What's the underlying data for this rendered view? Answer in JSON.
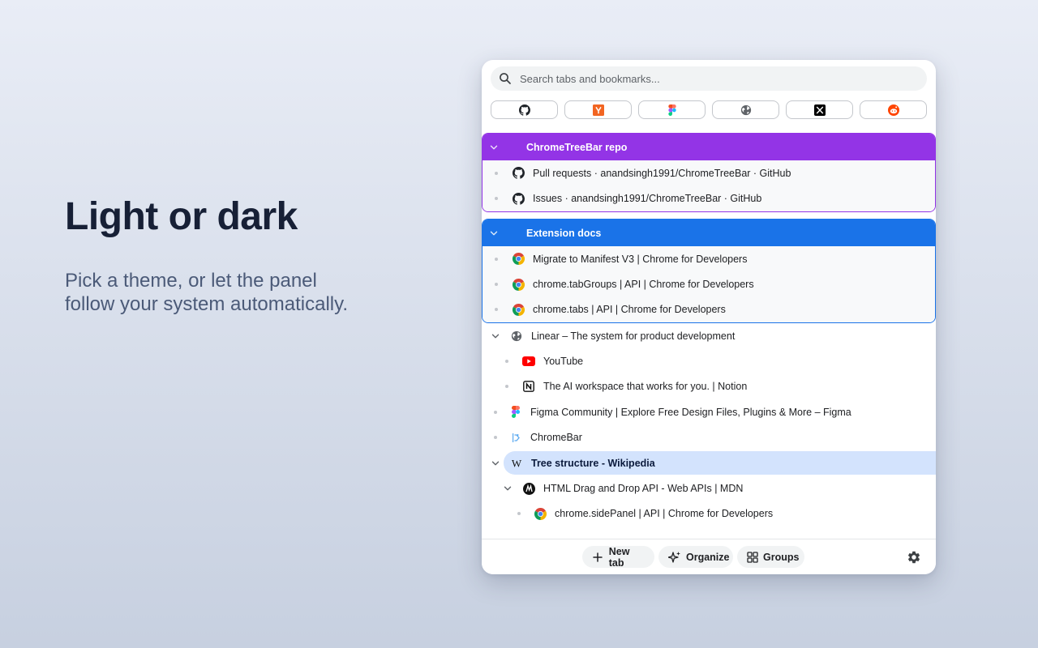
{
  "hero": {
    "title": "Light or dark",
    "subtitle_line1": "Pick a theme, or let the panel",
    "subtitle_line2": "follow your system automatically."
  },
  "search": {
    "placeholder": "Search tabs and bookmarks..."
  },
  "pinned": [
    {
      "icon": "github-icon"
    },
    {
      "icon": "ycombinator-icon"
    },
    {
      "icon": "figma-icon"
    },
    {
      "icon": "globe-icon"
    },
    {
      "icon": "x-icon"
    },
    {
      "icon": "reddit-icon"
    }
  ],
  "groups": [
    {
      "name": "ChromeTreeBar repo",
      "color": "#9334e6",
      "tabs": [
        {
          "title": "Pull requests · anandsingh1991/ChromeTreeBar · GitHub",
          "icon": "github-icon"
        },
        {
          "title": "Issues · anandsingh1991/ChromeTreeBar · GitHub",
          "icon": "github-icon"
        }
      ]
    },
    {
      "name": "Extension docs",
      "color": "#1a73e8",
      "tabs": [
        {
          "title": "Migrate to Manifest V3  |  Chrome for Developers",
          "icon": "chrome-icon"
        },
        {
          "title": "chrome.tabGroups  |  API  |  Chrome for Developers",
          "icon": "chrome-icon"
        },
        {
          "title": "chrome.tabs  |  API  |  Chrome for Developers",
          "icon": "chrome-icon"
        }
      ]
    }
  ],
  "tree": [
    {
      "title": "Linear – The system for product development",
      "icon": "globe-icon"
    },
    {
      "title": "YouTube",
      "icon": "youtube-icon"
    },
    {
      "title": "The AI workspace that works for you. | Notion",
      "icon": "notion-icon"
    },
    {
      "title": "Figma Community | Explore Free Design Files, Plugins & More – Figma",
      "icon": "figma-icon"
    },
    {
      "title": "ChromeBar",
      "icon": "chromebar-icon"
    },
    {
      "title": "Tree structure - Wikipedia",
      "icon": "wikipedia-icon"
    },
    {
      "title": "HTML Drag and Drop API - Web APIs | MDN",
      "icon": "mdn-icon"
    },
    {
      "title": "chrome.sidePanel  |  API  |  Chrome for Developers",
      "icon": "chrome-icon"
    }
  ],
  "footer": {
    "new_tab": "New tab",
    "organize": "Organize",
    "groups": "Groups"
  },
  "colors": {
    "selected_row": "#d3e3fd",
    "accent_purple": "#9334e6",
    "accent_blue": "#1a73e8"
  }
}
